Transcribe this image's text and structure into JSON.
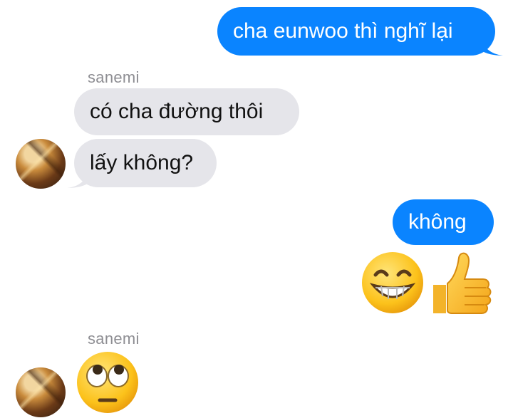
{
  "messages": {
    "m1": {
      "text": "cha eunwoo thì nghĩ lại"
    },
    "sender1": "sanemi",
    "m2": {
      "text": "có cha đường thôi"
    },
    "m3": {
      "text": "lấy không?"
    },
    "m4": {
      "text": "không"
    },
    "sender2": "sanemi"
  },
  "icons": {
    "grinning": "grinning-face-emoji",
    "thumbs_up": "thumbs-up-emoji",
    "eye_roll": "face-with-rolling-eyes-emoji"
  },
  "colors": {
    "outgoing": "#0a84ff",
    "incoming": "#e5e5ea",
    "sender_label": "#8e8e93"
  }
}
